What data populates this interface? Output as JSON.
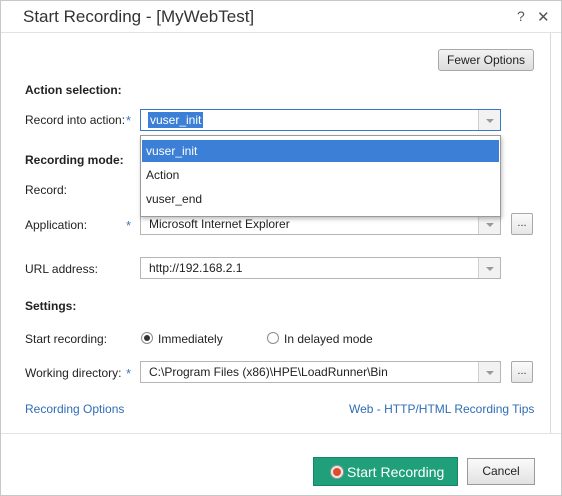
{
  "window": {
    "title": "Start Recording - [MyWebTest]",
    "help_label": "?",
    "close_label": "✕"
  },
  "options": {
    "fewer_label": "Fewer Options"
  },
  "action_selection": {
    "heading": "Action selection:",
    "record_into_label": "Record into action:",
    "selected_value": "vuser_init",
    "dropdown_items": [
      "vuser_init",
      "Action",
      "vuser_end"
    ]
  },
  "recording_mode": {
    "heading": "Recording mode:",
    "record_label": "Record:",
    "application_label": "Application:",
    "application_value": "Microsoft Internet Explorer",
    "url_label": "URL address:",
    "url_value": "http://192.168.2.1"
  },
  "settings": {
    "heading": "Settings:",
    "start_label": "Start recording:",
    "immediately_label": "Immediately",
    "delayed_label": "In delayed mode",
    "workdir_label": "Working directory:",
    "workdir_value": "C:\\Program Files (x86)\\HPE\\LoadRunner\\Bin"
  },
  "links": {
    "recording_options": "Recording Options",
    "tips": "Web - HTTP/HTML Recording Tips"
  },
  "buttons": {
    "start_recording": "Start Recording",
    "cancel": "Cancel",
    "browse": "..."
  },
  "required_marker": "*",
  "colors": {
    "accent": "#3b7fd6",
    "primary_button": "#20a07a",
    "link": "#2f6db5"
  }
}
